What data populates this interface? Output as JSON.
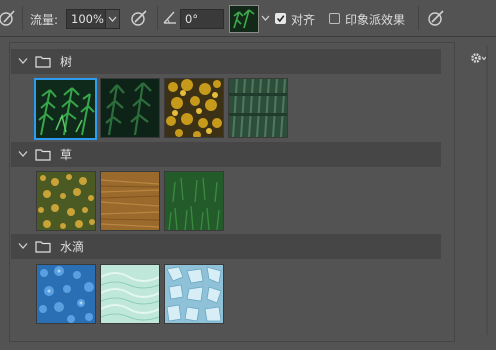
{
  "toolbar": {
    "flow_label": "流量:",
    "flow_value": "100%",
    "angle_value": "0°",
    "align_label": "对齐",
    "align_checked": true,
    "impressionist_label": "印象派效果",
    "impressionist_checked": false
  },
  "groups": [
    {
      "name": "树",
      "expanded": true,
      "presets": [
        "fern-leaves",
        "dark-pine",
        "autumn-foliage",
        "pine-forest-aerial"
      ],
      "selected_index": 0
    },
    {
      "name": "草",
      "expanded": true,
      "presets": [
        "dry-grass-flowers",
        "straw",
        "green-grass"
      ]
    },
    {
      "name": "水滴",
      "expanded": true,
      "presets": [
        "blue-droplets",
        "light-water-ripples",
        "ice-crystals"
      ]
    }
  ]
}
